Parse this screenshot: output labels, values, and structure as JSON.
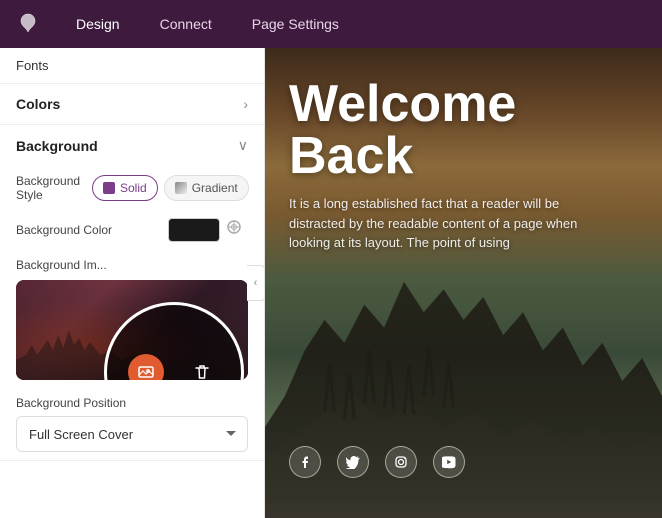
{
  "nav": {
    "items": [
      {
        "label": "Design",
        "active": true
      },
      {
        "label": "Connect",
        "active": false
      },
      {
        "label": "Page Settings",
        "active": false
      }
    ]
  },
  "sidebar": {
    "fonts_label": "Fonts",
    "colors_section": {
      "label": "Colors"
    },
    "background_section": {
      "label": "Background",
      "style_label": "Background Style",
      "solid_btn": "Solid",
      "gradient_btn": "Gradient",
      "color_label": "Background Color",
      "image_label": "Background Im...",
      "position_label": "Background Position",
      "position_value": "Full Screen Cover"
    }
  },
  "canvas": {
    "title_line1": "Welcome",
    "title_line2": "Back",
    "body_text": "It is a long established fact that a reader will be distracted by the readable content of a page when looking at its layout. The point of using",
    "social_icons": [
      "facebook",
      "twitter",
      "instagram",
      "youtube"
    ]
  },
  "icons": {
    "chevron_right": "›",
    "chevron_down": "∨",
    "chevron_left": "‹",
    "facebook": "f",
    "twitter": "t",
    "instagram": "◻",
    "youtube": "▶"
  }
}
